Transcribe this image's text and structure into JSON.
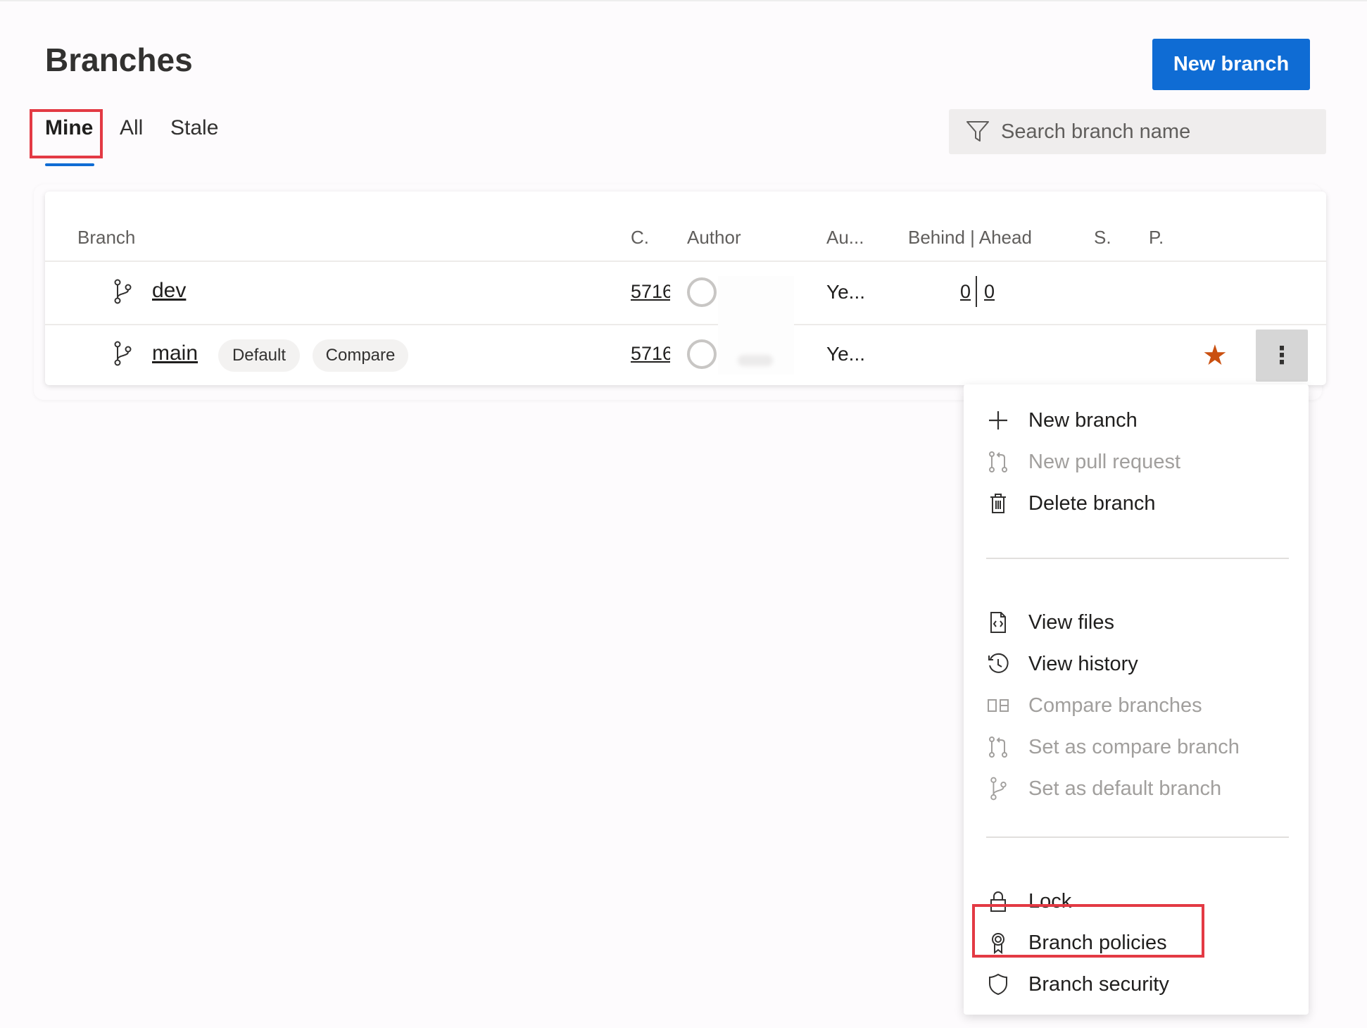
{
  "header": {
    "title": "Branches",
    "new_branch_label": "New branch"
  },
  "tabs": [
    {
      "label": "Mine",
      "active": true
    },
    {
      "label": "All",
      "active": false
    },
    {
      "label": "Stale",
      "active": false
    }
  ],
  "search": {
    "placeholder": "Search branch name"
  },
  "table": {
    "columns": [
      "Branch",
      "C.",
      "Author",
      "Au...",
      "Behind | Ahead",
      "S.",
      "P."
    ],
    "rows": [
      {
        "branch": "dev",
        "commit": "5716",
        "author_updated": "Ye...",
        "behind": "0",
        "ahead": "0"
      },
      {
        "branch": "main",
        "badges": [
          "Default",
          "Compare"
        ],
        "commit": "5716",
        "author_updated": "Ye...",
        "favorite": true,
        "more_label": "⋮"
      }
    ]
  },
  "context_menu": {
    "items": [
      {
        "label": "New branch",
        "icon": "plus-icon",
        "enabled": true
      },
      {
        "label": "New pull request",
        "icon": "pull-request-icon",
        "enabled": false
      },
      {
        "label": "Delete branch",
        "icon": "trash-icon",
        "enabled": true
      },
      {
        "label": "View files",
        "icon": "code-file-icon",
        "enabled": true
      },
      {
        "label": "View history",
        "icon": "history-icon",
        "enabled": true
      },
      {
        "label": "Compare branches",
        "icon": "compare-icon",
        "enabled": false
      },
      {
        "label": "Set as compare branch",
        "icon": "pull-request-icon",
        "enabled": false
      },
      {
        "label": "Set as default branch",
        "icon": "branch-icon",
        "enabled": false
      },
      {
        "label": "Lock",
        "icon": "lock-icon",
        "enabled": true
      },
      {
        "label": "Branch policies",
        "icon": "ribbon-icon",
        "enabled": true
      },
      {
        "label": "Branch security",
        "icon": "shield-icon",
        "enabled": true
      }
    ]
  },
  "colors": {
    "accent": "#0f6cd4",
    "highlight": "#e33a44",
    "star": "#ca5010",
    "disabled_text": "#a19f9d"
  }
}
